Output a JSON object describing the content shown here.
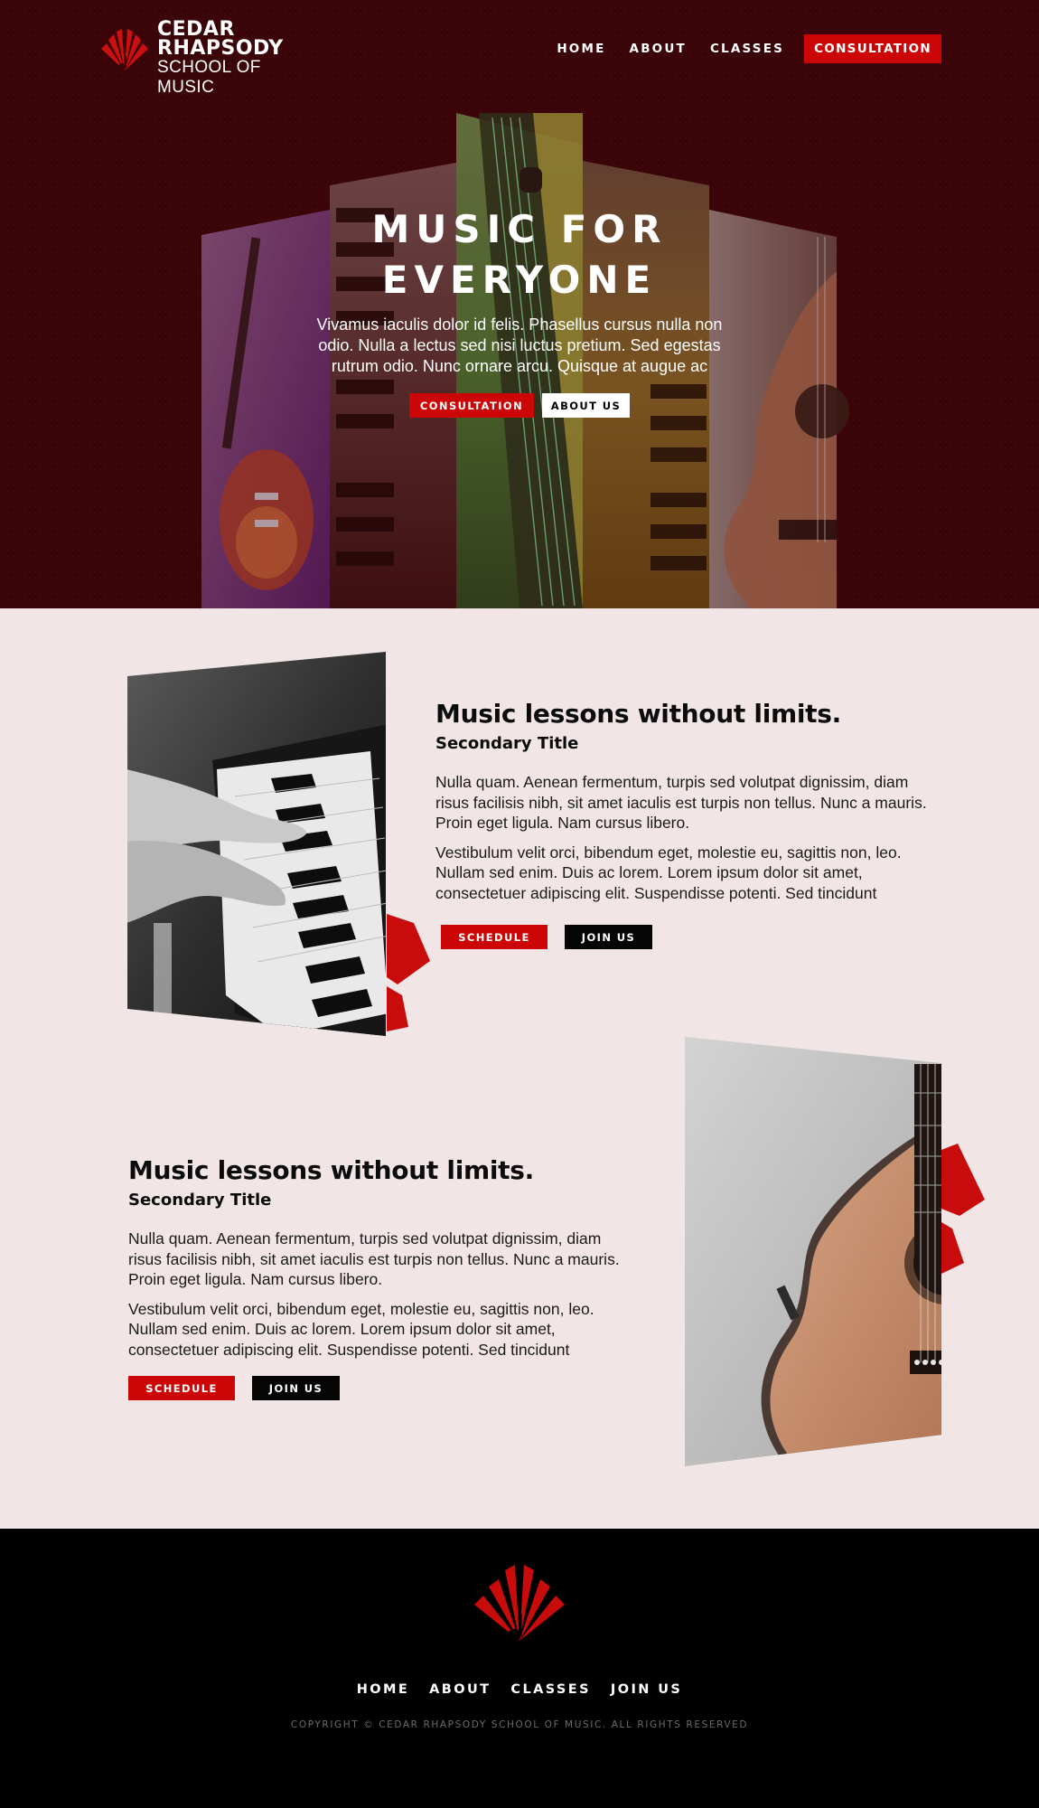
{
  "brand": {
    "line1": "CEDAR",
    "line2": "RHAPSODY",
    "line3": "SCHOOL OF MUSIC",
    "logo_icon": "fan-music-note-logo"
  },
  "nav": {
    "items": [
      "HOME",
      "ABOUT",
      "CLASSES"
    ],
    "cta": "CONSULTATION"
  },
  "hero": {
    "title_line1": "MUSIC FOR",
    "title_line2": "EVERYONE",
    "body": "Vivamus iaculis dolor id felis. Phasellus cursus nulla non odio. Nulla a lectus sed nisi luctus pretium. Sed egestas rutrum odio. Nunc ornare arcu. Quisque at augue ac",
    "btn_primary": "CONSULTATION",
    "btn_secondary": "ABOUT US"
  },
  "features": [
    {
      "title": "Music lessons without limits.",
      "subtitle": "Secondary Title",
      "p1": "Nulla quam. Aenean fermentum, turpis sed volutpat dignissim, diam risus facilisis nibh, sit amet iaculis est turpis non tellus. Nunc a mauris. Proin eget ligula. Nam cursus libero.",
      "p2": "Vestibulum velit orci, bibendum eget, molestie eu, sagittis non, leo. Nullam sed enim. Duis ac lorem. Lorem ipsum dolor sit amet, consectetuer adipiscing elit. Suspendisse potenti. Sed tincidunt",
      "btn1": "SCHEDULE",
      "btn2": "JOIN US",
      "image": "piano-hands-photo"
    },
    {
      "title": "Music lessons without limits.",
      "subtitle": "Secondary Title",
      "p1": "Nulla quam. Aenean fermentum, turpis sed volutpat dignissim, diam risus facilisis nibh, sit amet iaculis est turpis non tellus. Nunc a mauris. Proin eget ligula. Nam cursus libero.",
      "p2": "Vestibulum velit orci, bibendum eget, molestie eu, sagittis non, leo. Nullam sed enim. Duis ac lorem. Lorem ipsum dolor sit amet, consectetuer adipiscing elit. Suspendisse potenti. Sed tincidunt",
      "btn1": "SCHEDULE",
      "btn2": "JOIN US",
      "image": "acoustic-guitar-photo"
    }
  ],
  "footer": {
    "nav": [
      "HOME",
      "ABOUT",
      "CLASSES",
      "JOIN US"
    ],
    "copyright": "COPYRIGHT © CEDAR RHAPSODY SCHOOL OF MUSIC. ALL RIGHTS RESERVED"
  },
  "colors": {
    "accent": "#cc0606",
    "hero_bg": "#3a0508",
    "page_bg": "#f1e5e6",
    "footer_bg": "#000000"
  }
}
